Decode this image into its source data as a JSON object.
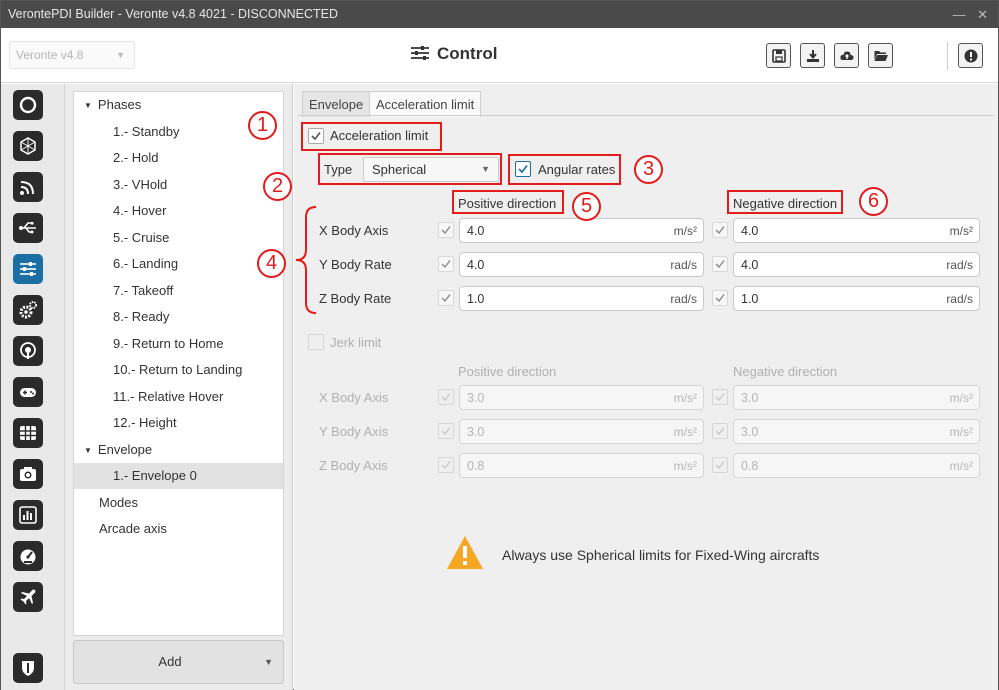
{
  "window": {
    "title": "VerontePDI Builder - Veronte v4.8 4021 - DISCONNECTED",
    "controls": "— ✕"
  },
  "header": {
    "version_select": "Veronte v4.8",
    "title": "Control",
    "toolbar_icons": [
      "save-icon",
      "download-icon",
      "cloud-upload-icon",
      "folder-open-icon",
      "info-icon"
    ]
  },
  "sidebar_icons": [
    "power-icon",
    "globe-icon",
    "signal-icon",
    "usb-icon",
    "control-sliders-icon",
    "gears-icon",
    "podcast-icon",
    "gamepad-icon",
    "grid-icon",
    "camera-icon",
    "chart-icon",
    "dashboard-icon",
    "plane-icon",
    "shield-icon"
  ],
  "active_sidebar": "control-sliders-icon",
  "tree": {
    "phases_label": "Phases",
    "phases": [
      "1.- Standby",
      "2.- Hold",
      "3.- VHold",
      "4.- Hover",
      "5.- Cruise",
      "6.- Landing",
      "7.- Takeoff",
      "8.- Ready",
      "9.- Return to Home",
      "10.- Return to Landing",
      "11.- Relative Hover",
      "12.- Height"
    ],
    "envelope_label": "Envelope",
    "envelope_items": [
      "1.- Envelope 0"
    ],
    "modes_label": "Modes",
    "arcade_label": "Arcade axis",
    "add_label": "Add"
  },
  "tabs": [
    "Envelope",
    "Acceleration limit"
  ],
  "accel": {
    "enable_label": "Acceleration limit",
    "type_label": "Type",
    "type_value": "Spherical",
    "angular_rates_label": "Angular rates",
    "pos_header": "Positive direction",
    "neg_header": "Negative direction",
    "rows": [
      {
        "label": "X Body Axis",
        "pos": "4.0",
        "pos_unit": "m/s²",
        "neg": "4.0",
        "neg_unit": "m/s²"
      },
      {
        "label": "Y Body Rate",
        "pos": "4.0",
        "pos_unit": "rad/s",
        "neg": "4.0",
        "neg_unit": "rad/s"
      },
      {
        "label": "Z Body Rate",
        "pos": "1.0",
        "pos_unit": "rad/s",
        "neg": "1.0",
        "neg_unit": "rad/s"
      }
    ]
  },
  "jerk": {
    "enable_label": "Jerk limit",
    "pos_header": "Positive direction",
    "neg_header": "Negative direction",
    "rows": [
      {
        "label": "X Body Axis",
        "pos": "3.0",
        "pos_unit": "m/s²",
        "neg": "3.0",
        "neg_unit": "m/s²"
      },
      {
        "label": "Y Body Axis",
        "pos": "3.0",
        "pos_unit": "m/s²",
        "neg": "3.0",
        "neg_unit": "m/s²"
      },
      {
        "label": "Z Body Axis",
        "pos": "0.8",
        "pos_unit": "m/s²",
        "neg": "0.8",
        "neg_unit": "m/s²"
      }
    ]
  },
  "callouts": [
    "1",
    "2",
    "3",
    "4",
    "5",
    "6"
  ],
  "warning": "Always use Spherical limits for Fixed-Wing aircrafts",
  "colors": {
    "accent": "#1c6fa3",
    "annotation": "#e31b1b",
    "warning": "#f5a623"
  }
}
